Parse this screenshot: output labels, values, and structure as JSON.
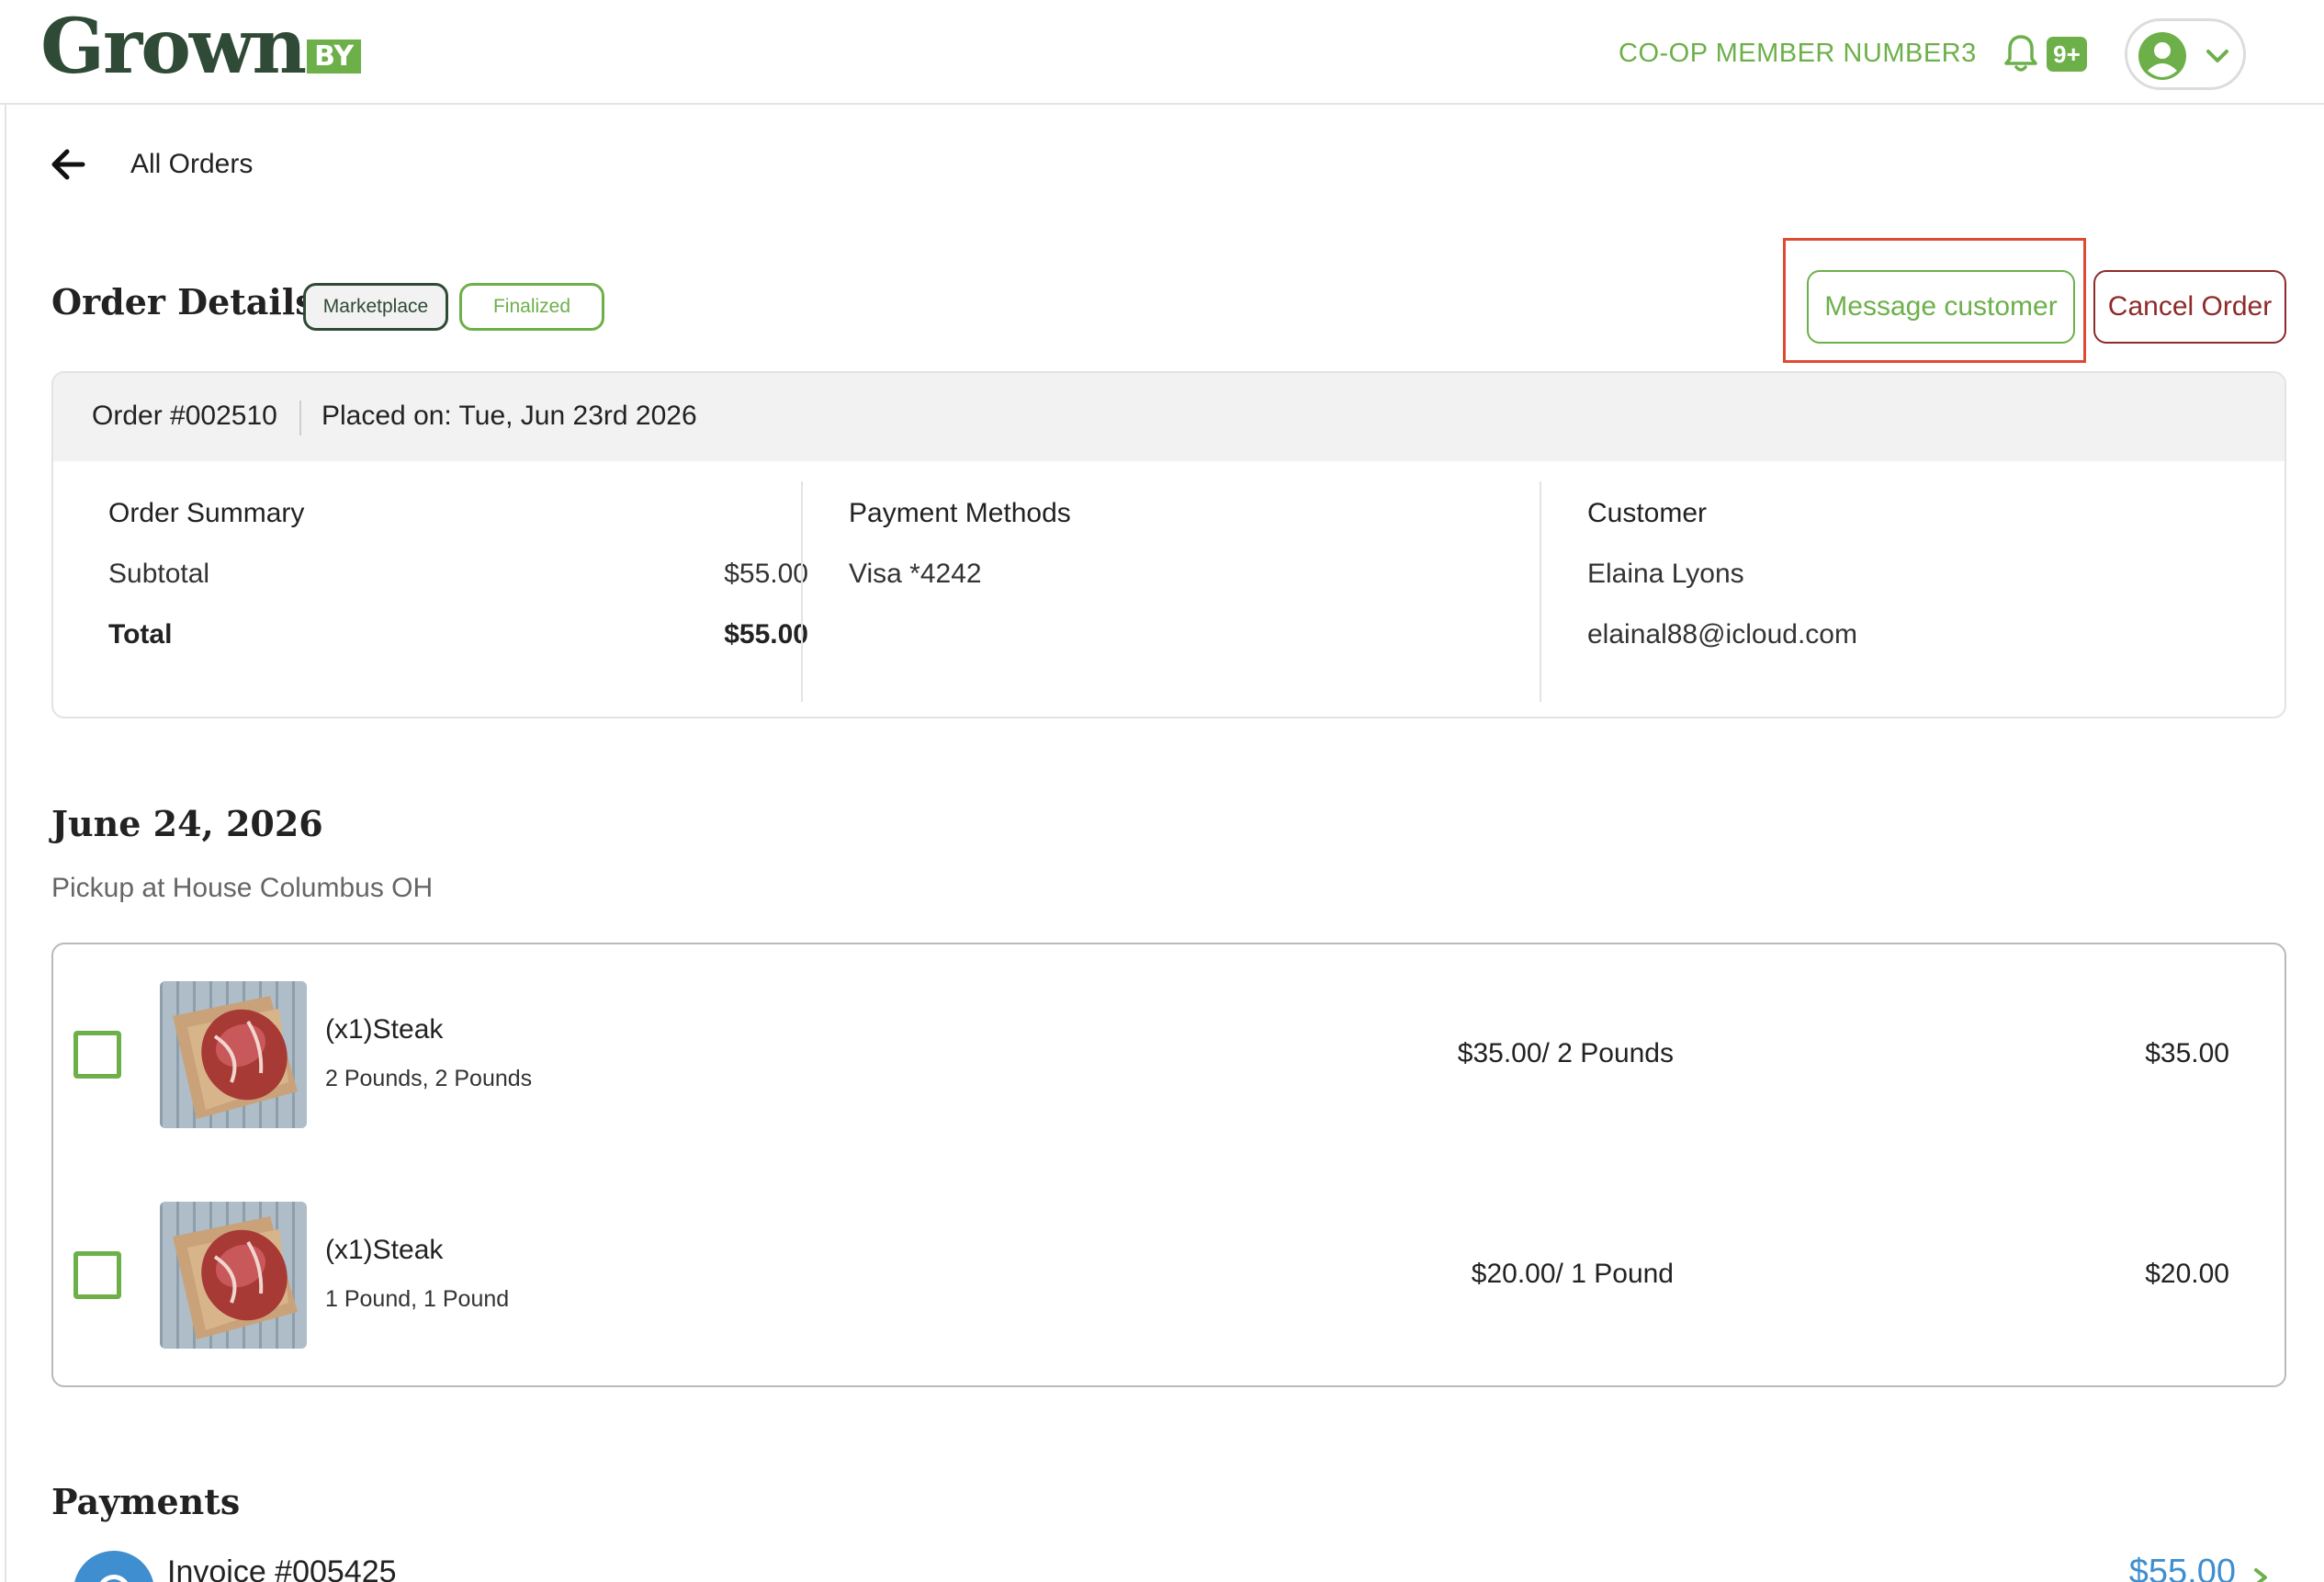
{
  "header": {
    "logo_word": "Grown",
    "logo_by": "BY",
    "member_label": "CO-OP MEMBER NUMBER3",
    "notification_badge": "9+"
  },
  "nav": {
    "back_label": "All Orders"
  },
  "page": {
    "title": "Order Details",
    "tags": [
      "Marketplace",
      "Finalized"
    ],
    "message_button": "Message customer",
    "cancel_button": "Cancel Order"
  },
  "order": {
    "number": "Order #002510",
    "placed_on": "Placed on: Tue, Jun 23rd 2026",
    "summary": {
      "heading": "Order Summary",
      "subtotal_label": "Subtotal",
      "subtotal_value": "$55.00",
      "total_label": "Total",
      "total_value": "$55.00"
    },
    "payment": {
      "heading": "Payment Methods",
      "method": "Visa *4242"
    },
    "customer": {
      "heading": "Customer",
      "name": "Elaina Lyons",
      "email": "elainal88@icloud.com"
    }
  },
  "fulfillment": {
    "date": "June 24, 2026",
    "pickup": "Pickup at House Columbus OH",
    "items": [
      {
        "name": "(x1)Steak",
        "variant": "2 Pounds, 2 Pounds",
        "unit_price": "$35.00/ 2 Pounds",
        "total": "$35.00"
      },
      {
        "name": "(x1)Steak",
        "variant": "1 Pound, 1 Pound",
        "unit_price": "$20.00/ 1 Pound",
        "total": "$20.00"
      }
    ]
  },
  "payments": {
    "title": "Payments",
    "invoice_label": "Invoice #005425",
    "invoice_amount": "$55.00"
  },
  "colors": {
    "brand_green": "#6db04a",
    "brand_dark": "#2f4a36",
    "cancel_red": "#8e2a2a",
    "highlight": "#e04a33",
    "payment_blue": "#3f8fd0"
  }
}
